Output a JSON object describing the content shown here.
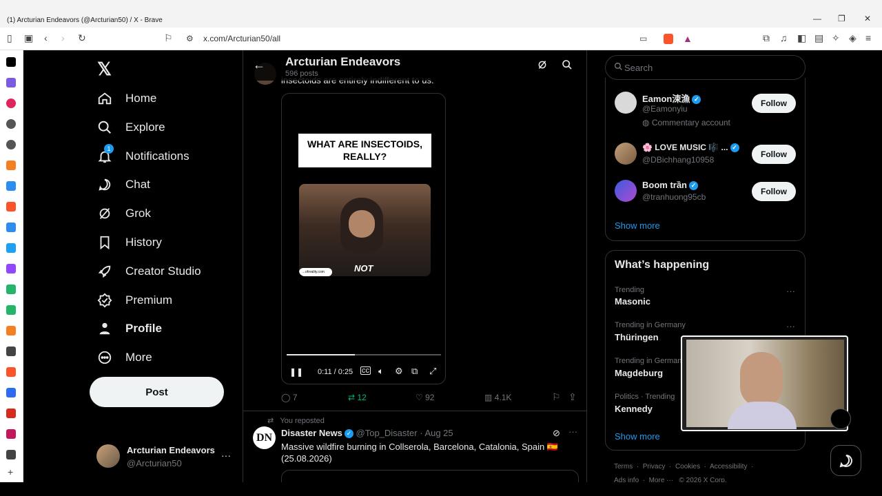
{
  "window": {
    "title": "(1) Arcturian Endeavors (@Arcturian50) / X - Brave",
    "url": "x.com/Arcturian50/all"
  },
  "nav": {
    "items": [
      {
        "label": "Home",
        "icon": "home-icon"
      },
      {
        "label": "Explore",
        "icon": "search-icon"
      },
      {
        "label": "Notifications",
        "icon": "bell-icon",
        "badge": "1"
      },
      {
        "label": "Chat",
        "icon": "chat-icon"
      },
      {
        "label": "Grok",
        "icon": "grok-icon"
      },
      {
        "label": "History",
        "icon": "bookmark-icon"
      },
      {
        "label": "Creator Studio",
        "icon": "rocket-icon"
      },
      {
        "label": "Premium",
        "icon": "premium-icon"
      },
      {
        "label": "Profile",
        "icon": "person-icon"
      },
      {
        "label": "More",
        "icon": "more-icon"
      }
    ],
    "post_label": "Post",
    "account": {
      "name": "Arcturian Endeavors",
      "handle": "@Arcturian50"
    }
  },
  "header": {
    "title": "Arcturian Endeavors",
    "posts": "596 posts"
  },
  "tweet1": {
    "text": "insectoids are entirely indifferent to us.",
    "video": {
      "caption": "WHAT ARE INSECTOIDS, REALLY?",
      "overlay_word": "NOT",
      "watermark": "…ofreality.com",
      "time": "0:11 / 0:25",
      "progress": 0.44
    },
    "stats": {
      "replies": "7",
      "reposts": "12",
      "likes": "92",
      "views": "4.1K"
    }
  },
  "tweet2": {
    "repost_label": "You reposted",
    "avatar_text": "DN",
    "name": "Disaster News",
    "handle": "@Top_Disaster",
    "date": "· Aug 25",
    "text": "Massive wildfire burning in Collserola, Barcelona, Catalonia, Spain 🇪🇸 (25.08.2026)"
  },
  "search": {
    "placeholder": "Search"
  },
  "who_to_follow": {
    "accounts": [
      {
        "name": "Eamon涑漁",
        "handle": "@Eamonyiu",
        "note": "Commentary account"
      },
      {
        "name": "🌸 LOVE MUSIC 🎼 ...",
        "handle": "@DBichhang10958"
      },
      {
        "name": "Boom trần",
        "handle": "@tranhuong95cb"
      }
    ],
    "follow_label": "Follow",
    "show_more": "Show more"
  },
  "happening": {
    "title": "What’s happening",
    "trends": [
      {
        "context": "Trending",
        "topic": "Masonic"
      },
      {
        "context": "Trending in Germany",
        "topic": "Thüringen"
      },
      {
        "context": "Trending in Germany",
        "topic": "Magdeburg"
      },
      {
        "context": "Politics · Trending",
        "topic": "Kennedy"
      }
    ],
    "show_more": "Show more"
  },
  "footer": {
    "links": [
      "Terms",
      "Privacy",
      "Cookies",
      "Accessibility"
    ],
    "line2": [
      "Ads info",
      "More ···",
      "© 2026 X Corp."
    ]
  },
  "colors": {
    "accent": "#1d9bf0",
    "repost_green": "#00ba7c",
    "background": "#000000"
  }
}
